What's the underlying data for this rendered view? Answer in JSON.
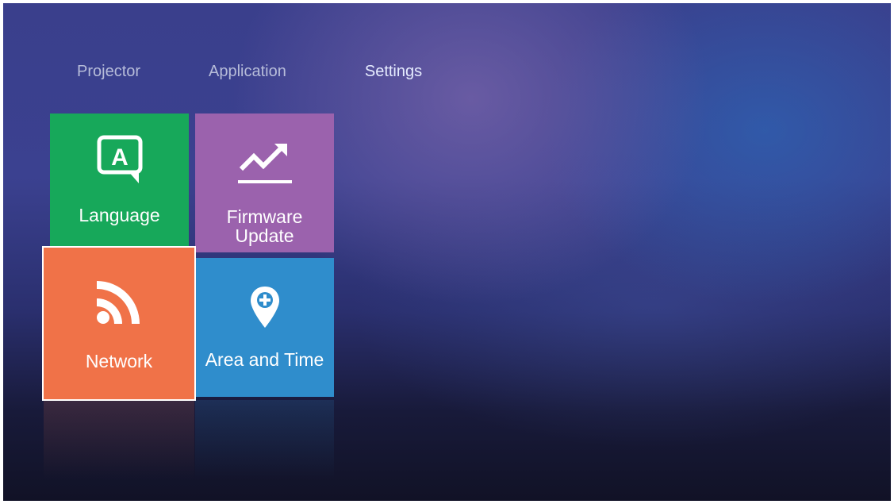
{
  "tabs": {
    "projector": "Projector",
    "application": "Application",
    "settings": "Settings",
    "active": "settings"
  },
  "tiles": {
    "language": {
      "label": "Language",
      "icon": "language-icon",
      "color": "#17a85a",
      "glyph": "A"
    },
    "firmware": {
      "label_line1": "Firmware",
      "label_line2": "Update",
      "icon": "trend-up-icon",
      "color": "#9b62ad"
    },
    "network": {
      "label": "Network",
      "icon": "rss-signal-icon",
      "color": "#f07248",
      "focused": true
    },
    "area": {
      "label": "Area and Time",
      "icon": "location-pin-icon",
      "color": "#2f8dcc"
    }
  },
  "colors": {
    "background_top": "#3b4190",
    "background_bottom": "#111226",
    "tab_highlight": "#4f8cff"
  }
}
